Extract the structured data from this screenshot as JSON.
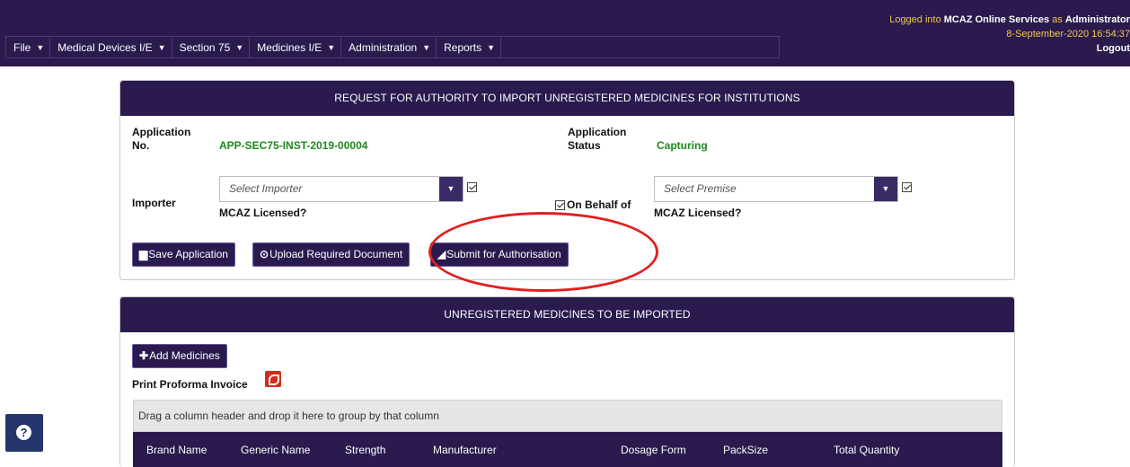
{
  "menu": [
    {
      "label": "File"
    },
    {
      "label": "Medical Devices I/E"
    },
    {
      "label": "Section 75"
    },
    {
      "label": "Medicines I/E"
    },
    {
      "label": "Administration"
    },
    {
      "label": "Reports"
    }
  ],
  "login": {
    "prefix": "Logged into ",
    "service": "MCAZ Online Services",
    "as": " as ",
    "user": "Administrator",
    "datetime": "8-September-2020 16:54:37",
    "logout": "Logout"
  },
  "application_panel": {
    "title": "REQUEST FOR AUTHORITY TO IMPORT UNREGISTERED MEDICINES FOR INSTITUTIONS",
    "app_no_label_1": "Application",
    "app_no_label_2": "No.",
    "app_no_value": "APP-SEC75-INST-2019-00004",
    "status_label_1": "Application",
    "status_label_2": "Status",
    "status_value": "Capturing",
    "importer_label": "Importer",
    "importer_placeholder": "Select Importer",
    "importer_licensed": "MCAZ Licensed?",
    "on_behalf_label": "On Behalf of",
    "premise_placeholder": "Select Premise",
    "premise_licensed": "MCAZ Licensed?",
    "buttons": {
      "save": "Save Application",
      "upload": "Upload Required Document",
      "submit": "Submit for Authorisation"
    }
  },
  "medicines_panel": {
    "title": "UNREGISTERED MEDICINES TO BE IMPORTED",
    "add_button": "Add Medicines",
    "print_label": "Print Proforma Invoice",
    "group_hint": "Drag a column header and drop it here to group by that column",
    "columns": [
      "Brand Name",
      "Generic Name",
      "Strength",
      "Manufacturer",
      "Dosage Form",
      "PackSize",
      "Total Quantity"
    ]
  },
  "colors": {
    "header_bg": "#2a1a4e",
    "status_green": "#1a8a1a",
    "annotation_red": "#e02020"
  },
  "icons": [
    "caret-down-icon",
    "save-icon",
    "upload-icon",
    "send-icon",
    "plus-icon",
    "pdf-icon",
    "help-icon",
    "checkbox-icon"
  ]
}
